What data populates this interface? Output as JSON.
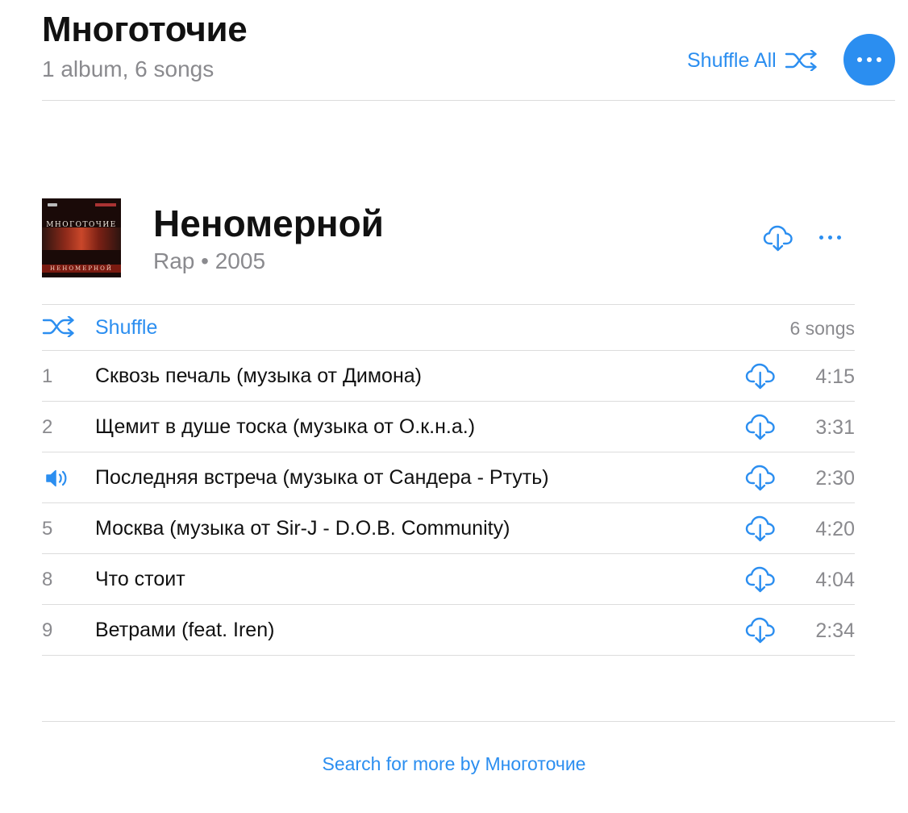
{
  "artist": {
    "name": "Многоточие",
    "summary": "1 album, 6 songs",
    "shuffle_all_label": "Shuffle All"
  },
  "album": {
    "title": "Неномерной",
    "genre_year": "Rap • 2005",
    "cover_word": "МНОГОТОЧИЕ",
    "cover_bottom": "НЕНОМЕРНОЙ"
  },
  "shuffle": {
    "label": "Shuffle",
    "count": "6 songs"
  },
  "tracks": [
    {
      "number": "1",
      "title": "Сквозь печаль (музыка от Димона)",
      "duration": "4:15",
      "playing": false
    },
    {
      "number": "2",
      "title": "Щемит в душе тоска (музыка от О.к.н.а.)",
      "duration": "3:31",
      "playing": false
    },
    {
      "number": "",
      "title": "Последняя встреча (музыка от Сандера - Ртуть)",
      "duration": "2:30",
      "playing": true
    },
    {
      "number": "5",
      "title": "Москва (музыка от Sir-J - D.O.B. Community)",
      "duration": "4:20",
      "playing": false
    },
    {
      "number": "8",
      "title": "Что стоит",
      "duration": "4:04",
      "playing": false
    },
    {
      "number": "9",
      "title": "Ветрами (feat. Iren)",
      "duration": "2:34",
      "playing": false
    }
  ],
  "footer": {
    "search_more": "Search for more by Многоточие"
  },
  "icons": {
    "shuffle": "shuffle-icon",
    "more": "more-icon",
    "download": "cloud-download-icon",
    "now_playing": "speaker-icon"
  },
  "colors": {
    "accent": "#2b8ef0",
    "secondary_text": "#8a8a8e",
    "divider": "#dcdcdc"
  }
}
